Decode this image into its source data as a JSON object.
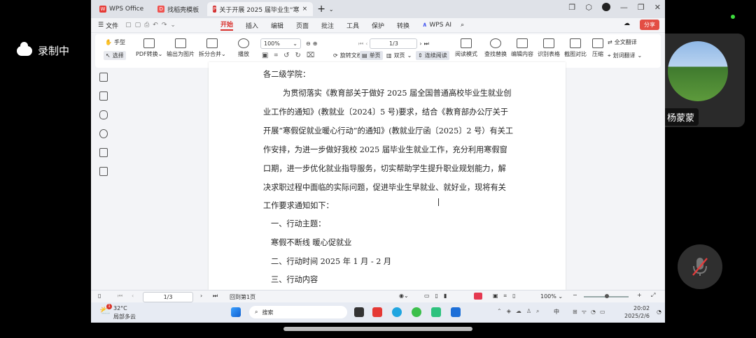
{
  "recording": {
    "label": "录制中"
  },
  "participant": {
    "name": "杨蒙蒙"
  },
  "tabs": [
    {
      "label": "WPS Office"
    },
    {
      "label": "找稻壳模板"
    },
    {
      "label": "关于开展 2025 届毕业生“寒"
    }
  ],
  "menu": {
    "file": "文件",
    "items": [
      "开始",
      "插入",
      "编辑",
      "页面",
      "批注",
      "工具",
      "保护",
      "转换"
    ],
    "ai": "WPS AI",
    "share": "分享"
  },
  "toolbar": {
    "hand": "手型",
    "select": "选择",
    "pdf_convert": "PDF转换",
    "export_image": "输出为图片",
    "split_merge": "拆分合并",
    "play": "播放",
    "zoom": "100%",
    "page": "1/3",
    "rotate": "旋转文档",
    "single": "单页",
    "double": "双页",
    "continuous": "连续阅读",
    "read_mode": "阅读模式",
    "find_replace": "查找替换",
    "edit_content": "编辑内容",
    "ocr_table": "识别表格",
    "screenshot_compare": "截图对比",
    "compress": "压缩",
    "full_translate": "全文翻译",
    "word_translate": "划词翻译"
  },
  "document": {
    "lines": [
      "各二级学院：",
      "为贯彻落实《教育部关于做好 2025 届全国普通高校毕业生就业创",
      "业工作的通知》(教就业〔2024〕5 号)要求，结合《教育部办公厅关于",
      "开展“寒假促就业暖心行动”的通知》(教就业厅函〔2025〕2 号）有关工",
      "作安排，为进一步做好我校  2025  届毕业生就业工作，充分利用寒假窗",
      "口期，进一步优化就业指导服务，切实帮助学生提升职业规划能力，解",
      "决求职过程中面临的实际问题，促进毕业生早就业、就好业，现将有关",
      "工作要求通知如下：",
      "一、行动主题：",
      "寒假不断线  暖心促就业",
      "二、行动时间  2025  年  1  月  - 2  月",
      "三、行动内容"
    ]
  },
  "statusbar": {
    "page": "1/3",
    "back": "回到第1页",
    "zoom": "100%"
  },
  "taskbar": {
    "temp": "32°C",
    "weather": "局部多云",
    "badge": "1",
    "search": "搜索",
    "lang": "中",
    "time": "20:02",
    "date": "2025/2/6"
  }
}
